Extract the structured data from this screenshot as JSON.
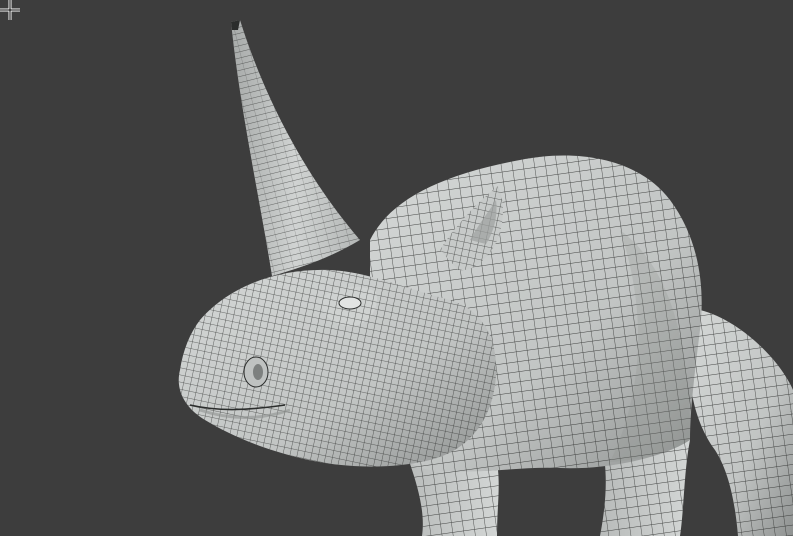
{
  "viewport": {
    "background_color": "#3d3d3d",
    "mesh_fill_color": "#c9cccb",
    "mesh_shadow_color": "#8f9291",
    "wire_color": "#2b2d2c",
    "cursor_icon": "crosshair-cursor-icon"
  }
}
